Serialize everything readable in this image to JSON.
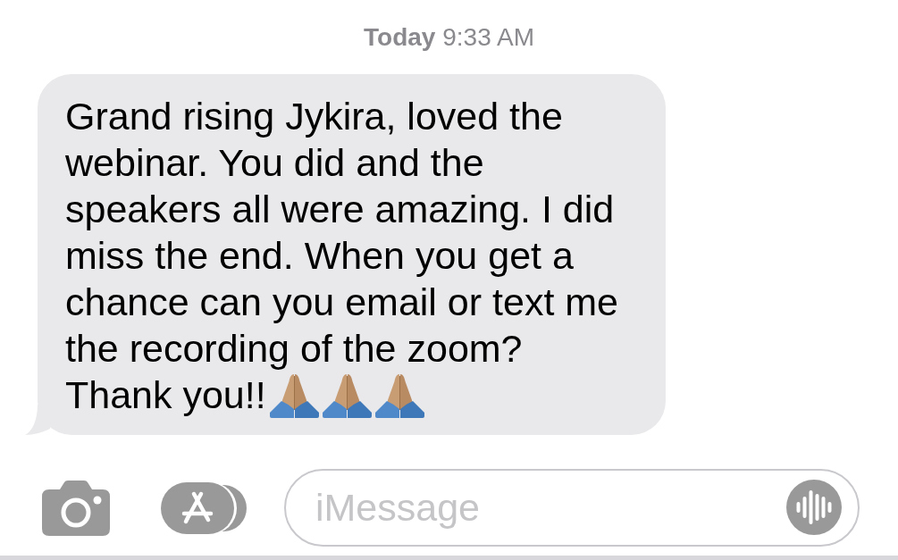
{
  "timestamp": {
    "day": "Today",
    "time": "9:33 AM"
  },
  "messages": [
    {
      "kind": "received",
      "text": "Grand rising Jykira, loved the webinar. You did and the speakers all were amazing. I did miss the end. When you get a chance can you email or text me the recording of the zoom?",
      "sign_off": "Thank you!!",
      "emojis": [
        {
          "kind": "folded-hands"
        },
        {
          "kind": "folded-hands"
        },
        {
          "kind": "folded-hands"
        }
      ]
    }
  ],
  "composer": {
    "placeholder": "iMessage"
  }
}
